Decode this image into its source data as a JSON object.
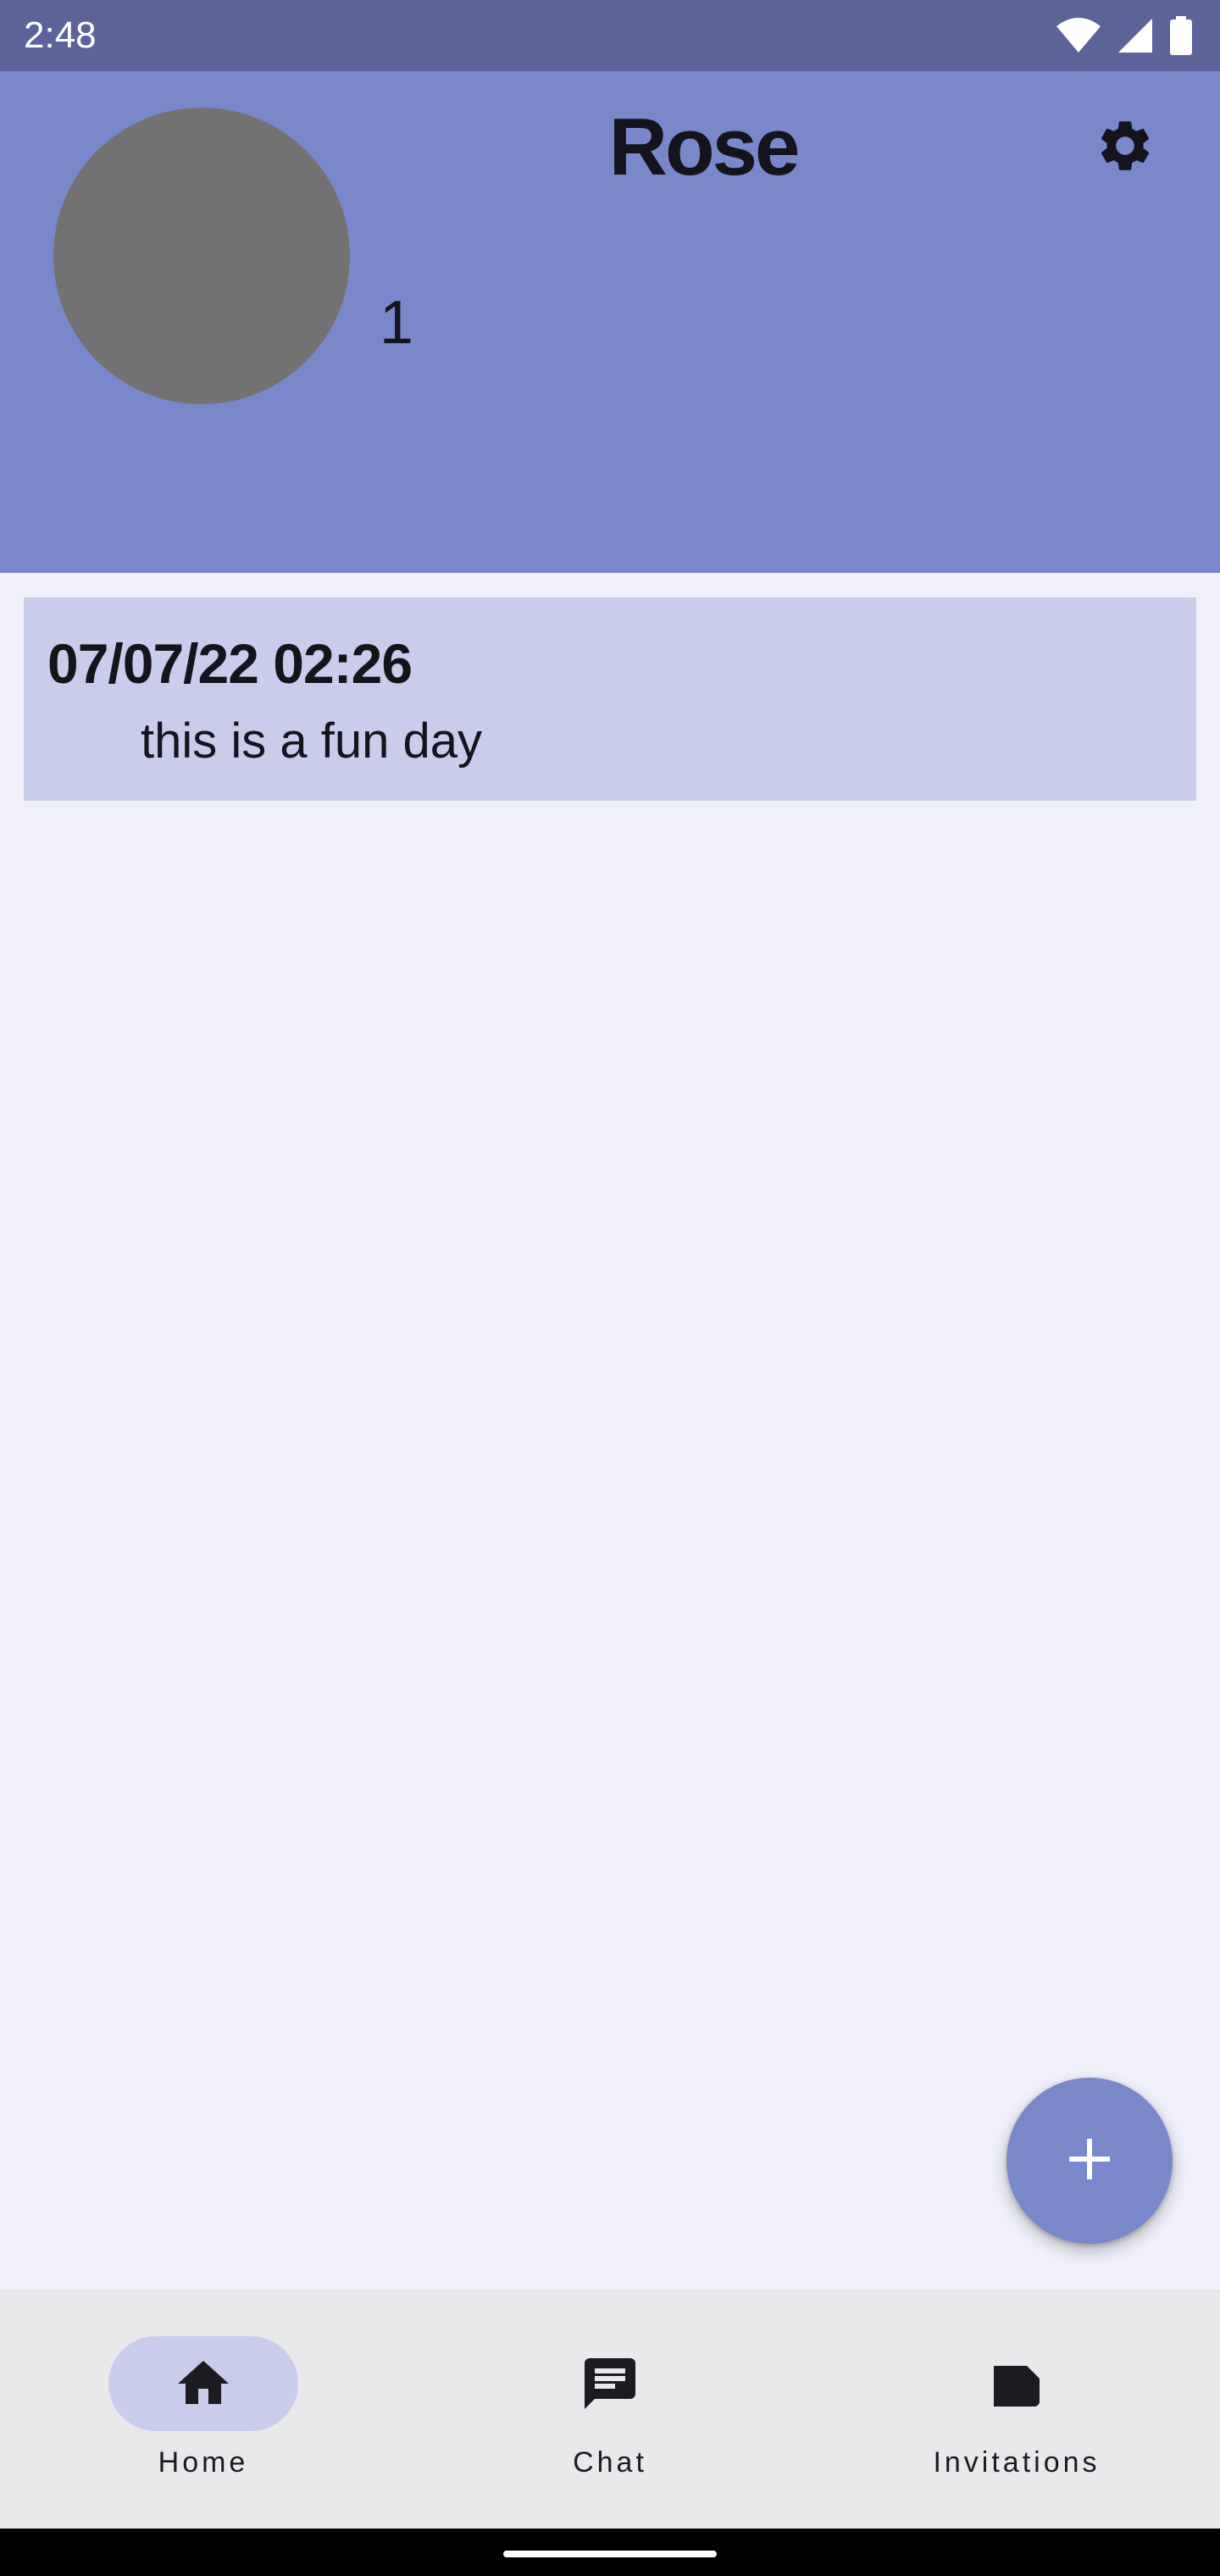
{
  "status_bar": {
    "time": "2:48",
    "icons": [
      "wifi-icon",
      "signal-icon",
      "battery-icon"
    ]
  },
  "profile": {
    "name": "Rose",
    "count": "1",
    "avatar_color": "#727272",
    "header_color": "#7987cb"
  },
  "posts": [
    {
      "date": "07/07/22 02:26",
      "text": "this is a fun day"
    }
  ],
  "fab": {
    "icon": "plus-icon"
  },
  "bottom_nav": {
    "items": [
      {
        "label": "Home",
        "icon": "home-icon",
        "selected": true
      },
      {
        "label": "Chat",
        "icon": "chat-icon",
        "selected": false
      },
      {
        "label": "Invitations",
        "icon": "invitations-icon",
        "selected": false
      }
    ]
  },
  "colors": {
    "background": "#eff0f9",
    "status_bar": "#5b6399",
    "card": "#c9cde9",
    "nav_background": "#e9e9eb",
    "nav_indicator": "#c9cde9"
  }
}
